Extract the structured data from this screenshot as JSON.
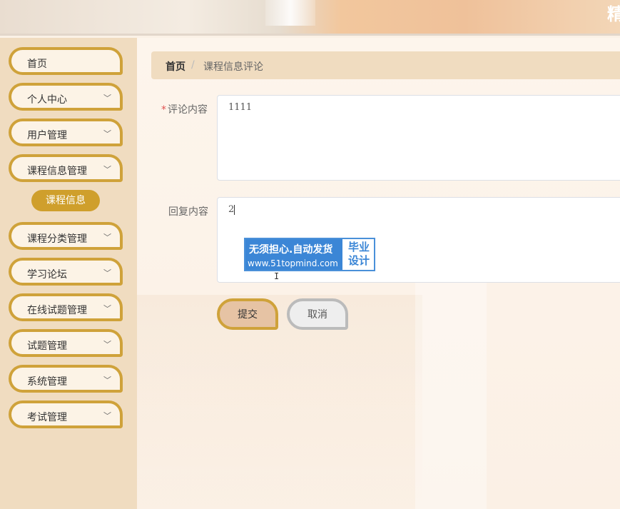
{
  "header": {
    "brand_char": "精"
  },
  "sidebar": {
    "items": [
      {
        "label": "首页",
        "has_chevron": false
      },
      {
        "label": "个人中心",
        "has_chevron": true
      },
      {
        "label": "用户管理",
        "has_chevron": true
      },
      {
        "label": "课程信息管理",
        "has_chevron": true
      },
      {
        "label": "课程分类管理",
        "has_chevron": true
      },
      {
        "label": "学习论坛",
        "has_chevron": true
      },
      {
        "label": "在线试题管理",
        "has_chevron": true
      },
      {
        "label": "试题管理",
        "has_chevron": true
      },
      {
        "label": "系统管理",
        "has_chevron": true
      },
      {
        "label": "考试管理",
        "has_chevron": true
      }
    ],
    "sub_item": "课程信息",
    "chevron": "﹀"
  },
  "breadcrumb": {
    "home": "首页",
    "separator": "/",
    "current": "课程信息评论"
  },
  "form": {
    "comment_label": "评论内容",
    "required_mark": "*",
    "comment_value": "1111",
    "reply_label": "回复内容",
    "reply_value": "2"
  },
  "watermark": {
    "line1": "无须担心.自动发货",
    "line2": "www.51topmind.com",
    "right_line1": "毕业",
    "right_line2": "设计"
  },
  "buttons": {
    "submit": "提交",
    "cancel": "取消"
  },
  "colors": {
    "accent": "#cfa23a",
    "sidebar_bg": "#f0dcc0",
    "submit_bg": "#e6c3a4",
    "watermark_blue": "#3b86d6"
  }
}
